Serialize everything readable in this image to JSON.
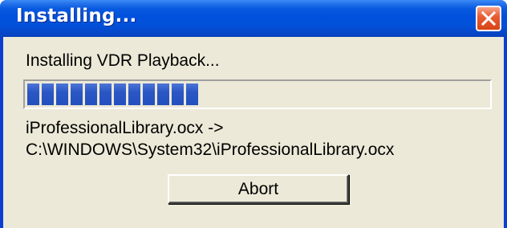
{
  "window": {
    "title": "Installing...",
    "close_icon": "close-x-icon"
  },
  "status": {
    "text": "Installing VDR Playback..."
  },
  "progress": {
    "filled_chunks": 12,
    "total_chunks": 31,
    "fraction": 0.39,
    "color": "#2a57c4"
  },
  "file": {
    "line1": "iProfessionalLibrary.ocx ->",
    "line2": "C:\\WINDOWS\\System32\\iProfessionalLibrary.ocx"
  },
  "buttons": {
    "abort_label": "Abort"
  },
  "colors": {
    "title_bar": "#0050dd",
    "client_bg": "#ece9d8",
    "close_button": "#e05a2e"
  }
}
